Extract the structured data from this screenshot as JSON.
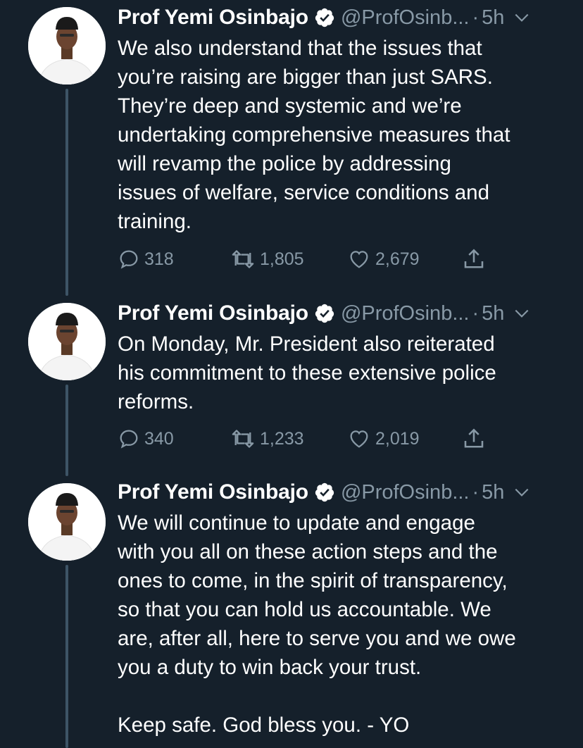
{
  "theme": {
    "background": "#15202b",
    "text_primary": "#ffffff",
    "text_secondary": "#8899a6",
    "thread_line": "#3d5466",
    "verified_badge": "#ffffff"
  },
  "tweets": [
    {
      "author_name": "Prof Yemi Osinbajo",
      "verified": true,
      "handle": "@ProfOsinb...",
      "separator": "·",
      "time": "5h",
      "lines": [
        "We also understand that the issues that",
        "you’re raising are bigger than just SARS.",
        "They’re deep and systemic and we’re",
        "undertaking comprehensive measures that",
        "will revamp the police by addressing",
        "issues of welfare, service conditions and",
        "training."
      ],
      "replies": "318",
      "retweets": "1,805",
      "likes": "2,679"
    },
    {
      "author_name": "Prof Yemi Osinbajo",
      "verified": true,
      "handle": "@ProfOsinb...",
      "separator": "·",
      "time": "5h",
      "lines": [
        "On Monday, Mr. President also reiterated",
        "his commitment to these extensive police",
        "reforms."
      ],
      "replies": "340",
      "retweets": "1,233",
      "likes": "2,019"
    },
    {
      "author_name": "Prof Yemi Osinbajo",
      "verified": true,
      "handle": "@ProfOsinb...",
      "separator": "·",
      "time": "5h",
      "lines": [
        "We will continue to update and engage",
        "with you all on these action steps and the",
        "ones to come, in the spirit of transparency,",
        "so that you can hold us accountable. We",
        "are, after all, here to serve you and we owe",
        "you a duty to win back your trust."
      ],
      "closing": "Keep safe. God bless you. - YO"
    }
  ],
  "icons": {
    "reply": "speech-bubble-icon",
    "retweet": "retweet-arrows-icon",
    "like": "heart-icon",
    "share": "share-arrow-icon",
    "verified": "verified-check-icon",
    "more": "chevron-down-icon"
  }
}
